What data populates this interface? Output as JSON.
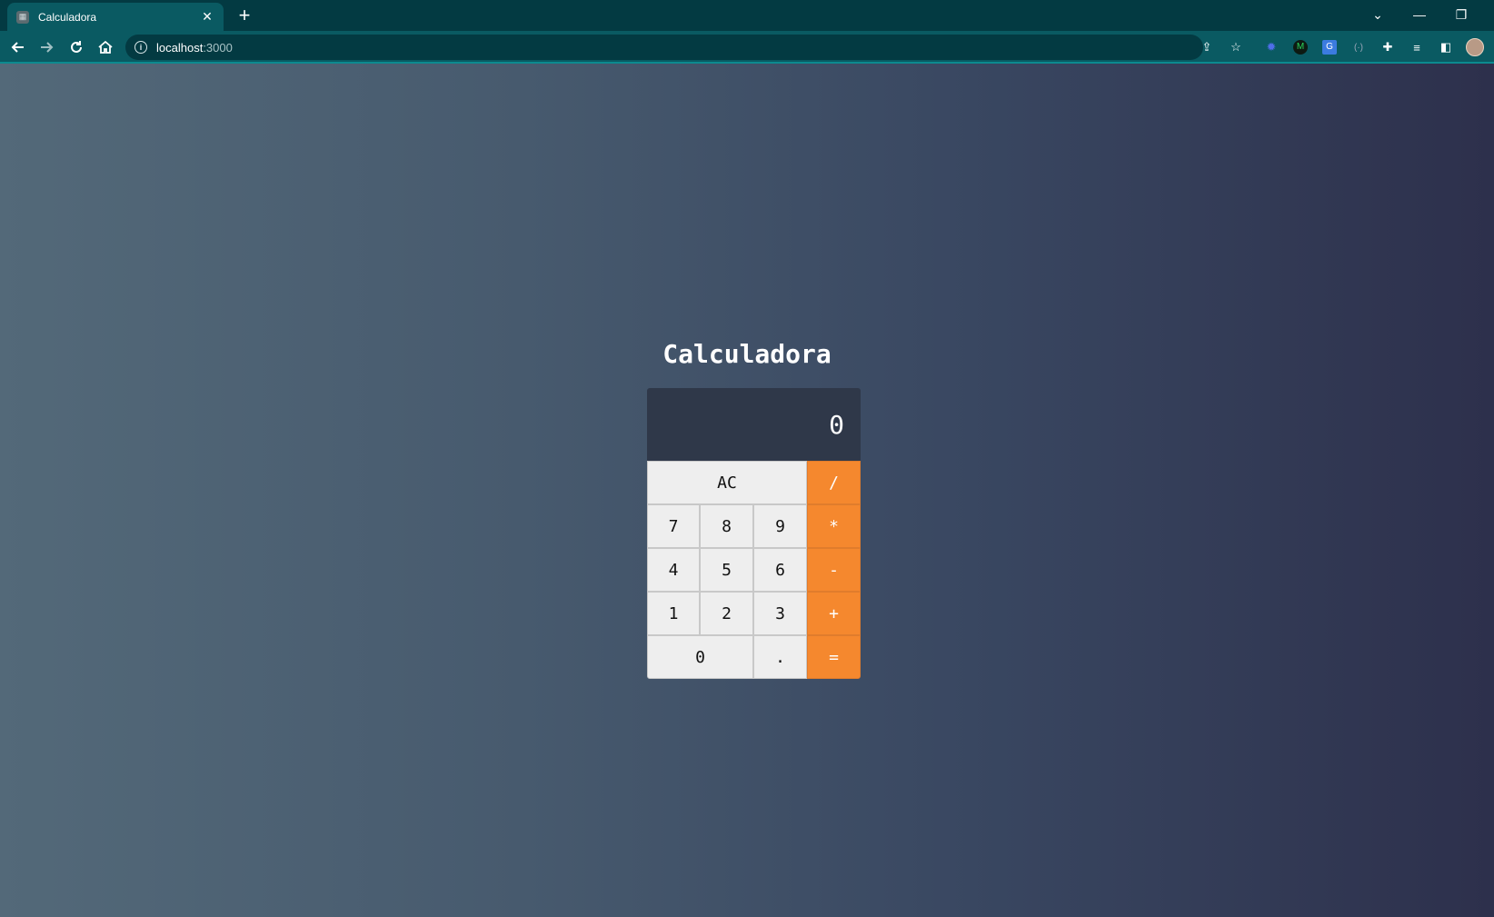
{
  "browser": {
    "tab_title": "Calculadora",
    "new_tab": "+",
    "url_host": "localhost",
    "url_port": ":3000"
  },
  "app": {
    "title": "Calculadora",
    "display": "0",
    "keys": {
      "ac": "AC",
      "divide": "/",
      "seven": "7",
      "eight": "8",
      "nine": "9",
      "multiply": "*",
      "four": "4",
      "five": "5",
      "six": "6",
      "minus": "-",
      "one": "1",
      "two": "2",
      "three": "3",
      "plus": "+",
      "zero": "0",
      "dot": ".",
      "equals": "="
    }
  },
  "colors": {
    "accent": "#f5882e",
    "display_bg": "#2f3849",
    "key_bg": "#eeeeee"
  }
}
